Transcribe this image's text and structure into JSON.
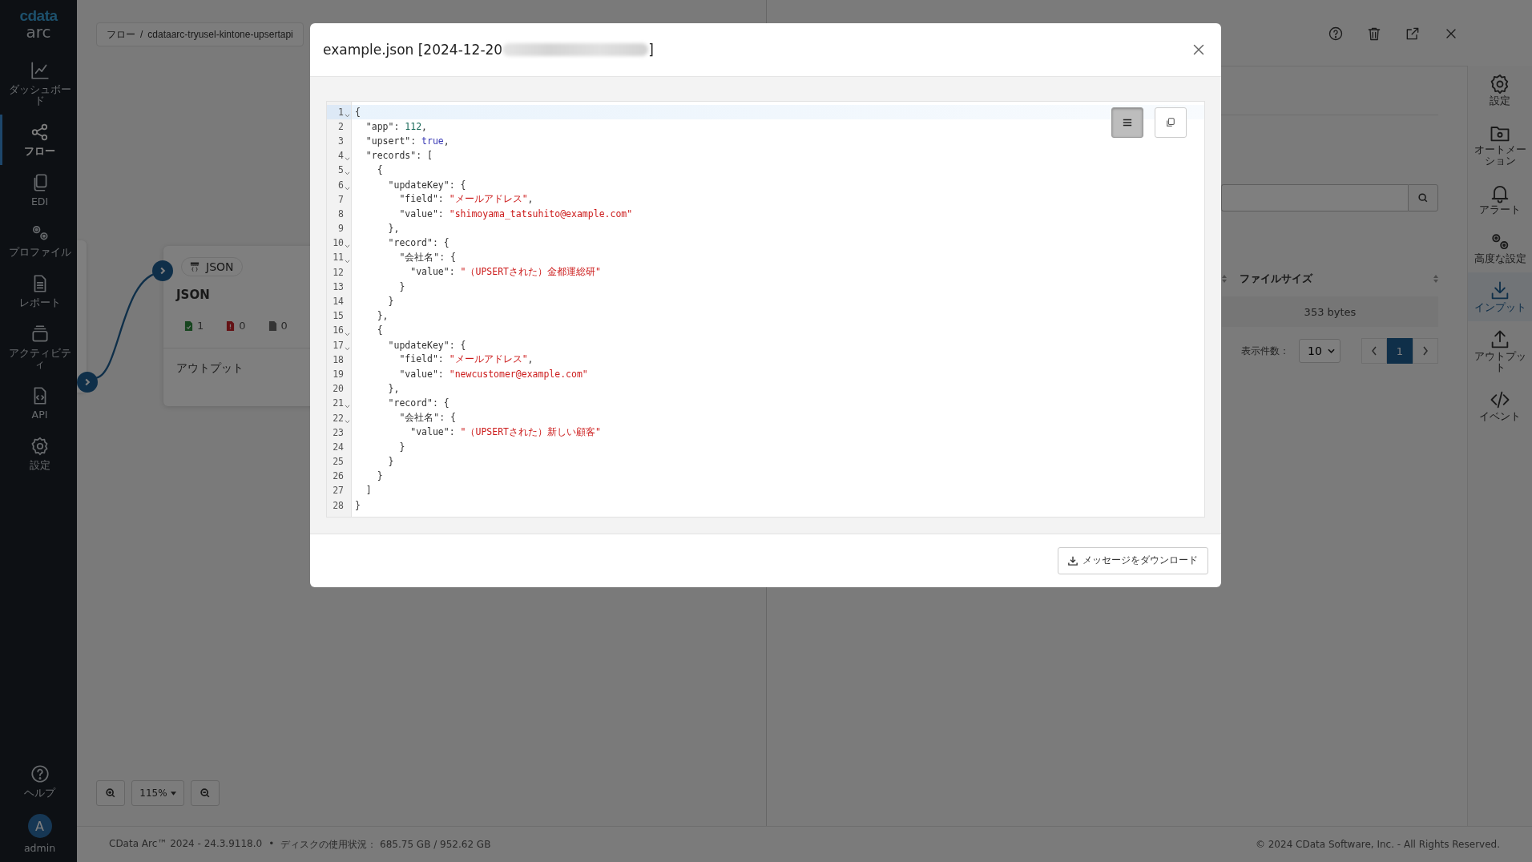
{
  "sidebar": {
    "logo_top": "cdata",
    "logo_bottom": "arc",
    "items": [
      {
        "kind": "dashboard",
        "label": "ダッシュボード",
        "selected": false
      },
      {
        "kind": "flow",
        "label": "フロー",
        "selected": true
      },
      {
        "kind": "edi",
        "label": "EDI",
        "selected": false
      },
      {
        "kind": "profile",
        "label": "プロファイル",
        "selected": false
      },
      {
        "kind": "report",
        "label": "レポート",
        "selected": false
      },
      {
        "kind": "activity",
        "label": "アクティビティ",
        "selected": false
      },
      {
        "kind": "api",
        "label": "API",
        "selected": false
      },
      {
        "kind": "settings",
        "label": "設定",
        "selected": false
      }
    ],
    "bottom_items": [
      {
        "kind": "help",
        "label": "ヘルプ"
      },
      {
        "kind": "user",
        "avatar": "A",
        "label": "admin"
      }
    ]
  },
  "breadcrumb": [
    "フロー",
    "/",
    "cdataarc-tryusel-kintone-upsertapi"
  ],
  "node": {
    "chip": "JSON",
    "title": "JSON",
    "counts": [
      {
        "kind": "success",
        "value": "1"
      },
      {
        "kind": "error",
        "value": "0"
      },
      {
        "kind": "pending",
        "value": "0"
      }
    ],
    "output": "アウトプット"
  },
  "zoom": {
    "level": "115%"
  },
  "panel": {
    "header_actions": [
      {
        "kind": "help"
      },
      {
        "kind": "delete"
      },
      {
        "kind": "open"
      },
      {
        "kind": "close"
      }
    ],
    "table": {
      "columns": [
        "ファイルサイズ"
      ],
      "rows": [
        [
          "353 bytes"
        ]
      ]
    },
    "page_size_label": "表示件数：",
    "page_size": "10",
    "pages": [
      {
        "label": "1",
        "selected": true
      }
    ]
  },
  "right_bar": [
    {
      "kind": "settings",
      "label": "設定",
      "selected": false
    },
    {
      "kind": "automation",
      "label": "オートメーション",
      "selected": false
    },
    {
      "kind": "alert",
      "label": "アラート",
      "selected": false
    },
    {
      "kind": "advanced",
      "label": "高度な設定",
      "selected": false
    },
    {
      "kind": "input",
      "label": "インプット",
      "selected": true
    },
    {
      "kind": "output",
      "label": "アウトプット",
      "selected": false
    },
    {
      "kind": "event",
      "label": "イベント",
      "selected": false
    }
  ],
  "footer": {
    "version": "CData Arc™ 2024 - 24.3.9118.0",
    "separator": "•",
    "disk": "ディスクの使用状況： 685.75 GB / 952.62 GB",
    "copyright": "© 2024 CData Software, Inc. - All Rights Reserved."
  },
  "modal": {
    "title": "example.json [2024-12-20",
    "title_end": "]",
    "tools": [
      {
        "kind": "wrap",
        "selected": true
      },
      {
        "kind": "copy",
        "selected": false
      }
    ],
    "lines": [
      {
        "number": "1",
        "fold": true,
        "active": true,
        "tokens": [
          {
            "kind": "plain",
            "text": "{"
          }
        ]
      },
      {
        "number": "2",
        "fold": false,
        "active": false,
        "tokens": [
          {
            "kind": "plain",
            "text": "  \"app\": "
          },
          {
            "kind": "number",
            "text": "112"
          },
          {
            "kind": "plain",
            "text": ","
          }
        ]
      },
      {
        "number": "3",
        "fold": false,
        "active": false,
        "tokens": [
          {
            "kind": "plain",
            "text": "  \"upsert\": "
          },
          {
            "kind": "bool",
            "text": "true"
          },
          {
            "kind": "plain",
            "text": ","
          }
        ]
      },
      {
        "number": "4",
        "fold": true,
        "active": false,
        "tokens": [
          {
            "kind": "plain",
            "text": "  \"records\": ["
          }
        ]
      },
      {
        "number": "5",
        "fold": true,
        "active": false,
        "tokens": [
          {
            "kind": "plain",
            "text": "    {"
          }
        ]
      },
      {
        "number": "6",
        "fold": true,
        "active": false,
        "tokens": [
          {
            "kind": "plain",
            "text": "      \"updateKey\": {"
          }
        ]
      },
      {
        "number": "7",
        "fold": false,
        "active": false,
        "tokens": [
          {
            "kind": "plain",
            "text": "        \"field\": "
          },
          {
            "kind": "string",
            "text": "\"メールアドレス\""
          },
          {
            "kind": "plain",
            "text": ","
          }
        ]
      },
      {
        "number": "8",
        "fold": false,
        "active": false,
        "tokens": [
          {
            "kind": "plain",
            "text": "        \"value\": "
          },
          {
            "kind": "string",
            "text": "\"shimoyama_tatsuhito@example.com\""
          }
        ]
      },
      {
        "number": "9",
        "fold": false,
        "active": false,
        "tokens": [
          {
            "kind": "plain",
            "text": "      },"
          }
        ]
      },
      {
        "number": "10",
        "fold": true,
        "active": false,
        "tokens": [
          {
            "kind": "plain",
            "text": "      \"record\": {"
          }
        ]
      },
      {
        "number": "11",
        "fold": true,
        "active": false,
        "tokens": [
          {
            "kind": "plain",
            "text": "        \"会社名\": {"
          }
        ]
      },
      {
        "number": "12",
        "fold": false,
        "active": false,
        "tokens": [
          {
            "kind": "plain",
            "text": "          \"value\": "
          },
          {
            "kind": "string",
            "text": "\"（UPSERTされた）金都運総研\""
          }
        ]
      },
      {
        "number": "13",
        "fold": false,
        "active": false,
        "tokens": [
          {
            "kind": "plain",
            "text": "        }"
          }
        ]
      },
      {
        "number": "14",
        "fold": false,
        "active": false,
        "tokens": [
          {
            "kind": "plain",
            "text": "      }"
          }
        ]
      },
      {
        "number": "15",
        "fold": false,
        "active": false,
        "tokens": [
          {
            "kind": "plain",
            "text": "    },"
          }
        ]
      },
      {
        "number": "16",
        "fold": true,
        "active": false,
        "tokens": [
          {
            "kind": "plain",
            "text": "    {"
          }
        ]
      },
      {
        "number": "17",
        "fold": true,
        "active": false,
        "tokens": [
          {
            "kind": "plain",
            "text": "      \"updateKey\": {"
          }
        ]
      },
      {
        "number": "18",
        "fold": false,
        "active": false,
        "tokens": [
          {
            "kind": "plain",
            "text": "        \"field\": "
          },
          {
            "kind": "string",
            "text": "\"メールアドレス\""
          },
          {
            "kind": "plain",
            "text": ","
          }
        ]
      },
      {
        "number": "19",
        "fold": false,
        "active": false,
        "tokens": [
          {
            "kind": "plain",
            "text": "        \"value\": "
          },
          {
            "kind": "string",
            "text": "\"newcustomer@example.com\""
          }
        ]
      },
      {
        "number": "20",
        "fold": false,
        "active": false,
        "tokens": [
          {
            "kind": "plain",
            "text": "      },"
          }
        ]
      },
      {
        "number": "21",
        "fold": true,
        "active": false,
        "tokens": [
          {
            "kind": "plain",
            "text": "      \"record\": {"
          }
        ]
      },
      {
        "number": "22",
        "fold": true,
        "active": false,
        "tokens": [
          {
            "kind": "plain",
            "text": "        \"会社名\": {"
          }
        ]
      },
      {
        "number": "23",
        "fold": false,
        "active": false,
        "tokens": [
          {
            "kind": "plain",
            "text": "          \"value\": "
          },
          {
            "kind": "string",
            "text": "\"（UPSERTされた）新しい顧客\""
          }
        ]
      },
      {
        "number": "24",
        "fold": false,
        "active": false,
        "tokens": [
          {
            "kind": "plain",
            "text": "        }"
          }
        ]
      },
      {
        "number": "25",
        "fold": false,
        "active": false,
        "tokens": [
          {
            "kind": "plain",
            "text": "      }"
          }
        ]
      },
      {
        "number": "26",
        "fold": false,
        "active": false,
        "tokens": [
          {
            "kind": "plain",
            "text": "    }"
          }
        ]
      },
      {
        "number": "27",
        "fold": false,
        "active": false,
        "tokens": [
          {
            "kind": "plain",
            "text": "  ]"
          }
        ]
      },
      {
        "number": "28",
        "fold": false,
        "active": false,
        "tokens": [
          {
            "kind": "plain",
            "text": "}"
          }
        ]
      }
    ],
    "download_button": "メッセージをダウンロード"
  }
}
